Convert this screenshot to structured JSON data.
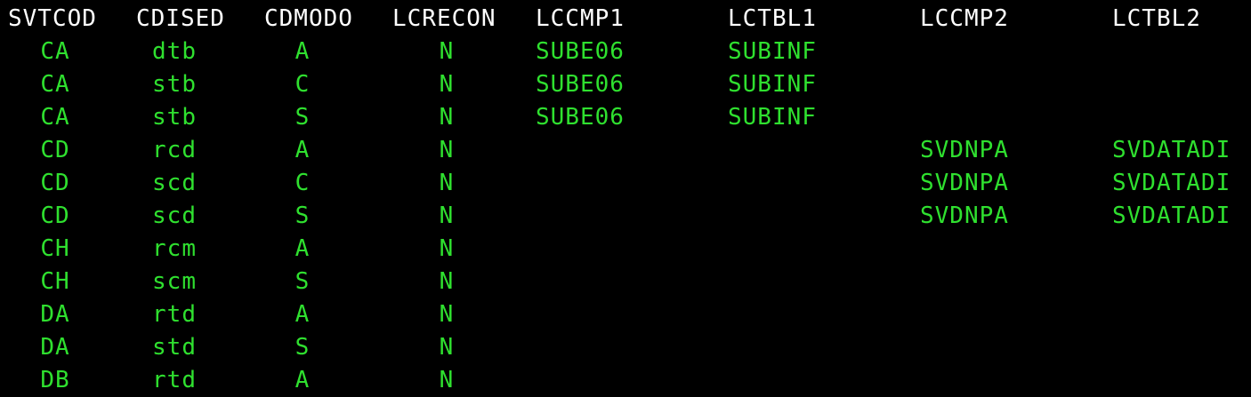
{
  "headers": [
    "SVTCOD",
    "CDISED",
    "CDMODO",
    "LCRECON",
    "LCCMP1",
    "LCTBL1",
    "LCCMP2",
    "LCTBL2"
  ],
  "rows": [
    [
      "CA",
      "dtb",
      "A",
      "N",
      "SUBE06",
      "SUBINF",
      "",
      ""
    ],
    [
      "CA",
      "stb",
      "C",
      "N",
      "SUBE06",
      "SUBINF",
      "",
      ""
    ],
    [
      "CA",
      "stb",
      "S",
      "N",
      "SUBE06",
      "SUBINF",
      "",
      ""
    ],
    [
      "CD",
      "rcd",
      "A",
      "N",
      "",
      "",
      "SVDNPA",
      "SVDATADI"
    ],
    [
      "CD",
      "scd",
      "C",
      "N",
      "",
      "",
      "SVDNPA",
      "SVDATADI"
    ],
    [
      "CD",
      "scd",
      "S",
      "N",
      "",
      "",
      "SVDNPA",
      "SVDATADI"
    ],
    [
      "CH",
      "rcm",
      "A",
      "N",
      "",
      "",
      "",
      ""
    ],
    [
      "CH",
      "scm",
      "S",
      "N",
      "",
      "",
      "",
      ""
    ],
    [
      "DA",
      "rtd",
      "A",
      "N",
      "",
      "",
      "",
      ""
    ],
    [
      "DA",
      "std",
      "S",
      "N",
      "",
      "",
      "",
      ""
    ],
    [
      "DB",
      "rtd",
      "A",
      "N",
      "",
      "",
      "",
      ""
    ]
  ]
}
